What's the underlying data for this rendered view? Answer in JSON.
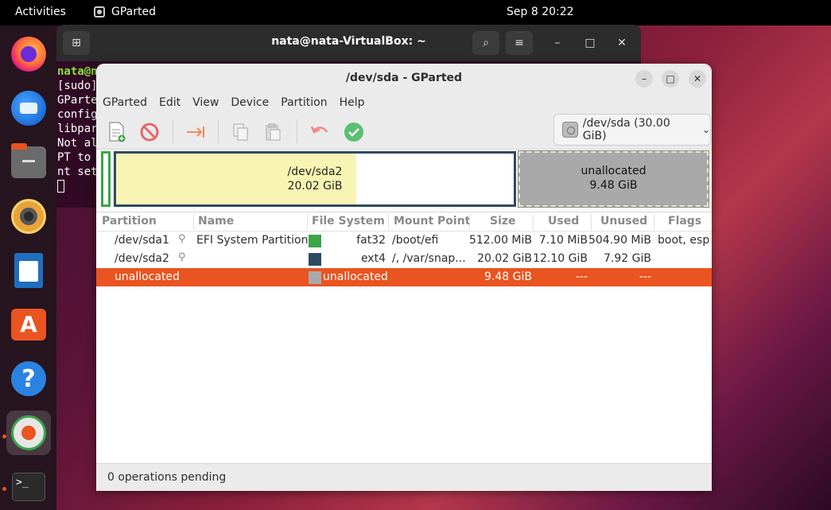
{
  "topbar": {
    "activities": "Activities",
    "app_name": "GParted",
    "clock": "Sep 8  20:22"
  },
  "dock": {
    "items": [
      "firefox-icon",
      "thunderbird-icon",
      "files-icon",
      "rhythmbox-icon",
      "libreoffice-writer-icon",
      "app-center-icon",
      "help-icon",
      "gparted-icon",
      "terminal-icon"
    ],
    "help_glyph": "?",
    "store_glyph": "A",
    "terminal_glyph": ">_"
  },
  "terminal": {
    "title": "nata@nata-VirtualBox: ~",
    "lines": [
      "nata@n",
      "[sudo]",
      "GParte",
      "config",
      "libpar",
      "Not al",
      "PT to",
      "nt set"
    ]
  },
  "gparted": {
    "title": "/dev/sda - GParted",
    "menu": [
      "GParted",
      "Edit",
      "View",
      "Device",
      "Partition",
      "Help"
    ],
    "device_select": "/dev/sda (30.00 GiB)",
    "map": {
      "sda2_name": "/dev/sda2",
      "sda2_size": "20.02 GiB",
      "sda2_used_fraction": 0.604,
      "unalloc_name": "unallocated",
      "unalloc_size": "9.48 GiB"
    },
    "columns": [
      "Partition",
      "Name",
      "File System",
      "Mount Point",
      "Size",
      "Used",
      "Unused",
      "Flags"
    ],
    "rows": [
      {
        "partition": "/dev/sda1",
        "name": "EFI System Partition",
        "fs": "fat32",
        "mount": "/boot/efi",
        "size": "512.00 MiB",
        "used": "7.10 MiB",
        "unused": "504.90 MiB",
        "flags": "boot, esp",
        "fs_color": "#3aa648"
      },
      {
        "partition": "/dev/sda2",
        "name": "",
        "fs": "ext4",
        "mount": "/, /var/snap...",
        "size": "20.02 GiB",
        "used": "12.10 GiB",
        "unused": "7.92 GiB",
        "flags": "",
        "fs_color": "#2e4a62"
      },
      {
        "partition": "unallocated",
        "name": "",
        "fs": "unallocated",
        "mount": "",
        "size": "9.48 GiB",
        "used": "---",
        "unused": "---",
        "flags": "",
        "fs_color": "#a9a9a9"
      }
    ],
    "status": "0 operations pending"
  },
  "colors": {
    "accent": "#e95420",
    "efi": "#3aa648",
    "ext4": "#2e4a62",
    "unallocated": "#a9a9a9",
    "used_fill": "#f7f4b4"
  }
}
